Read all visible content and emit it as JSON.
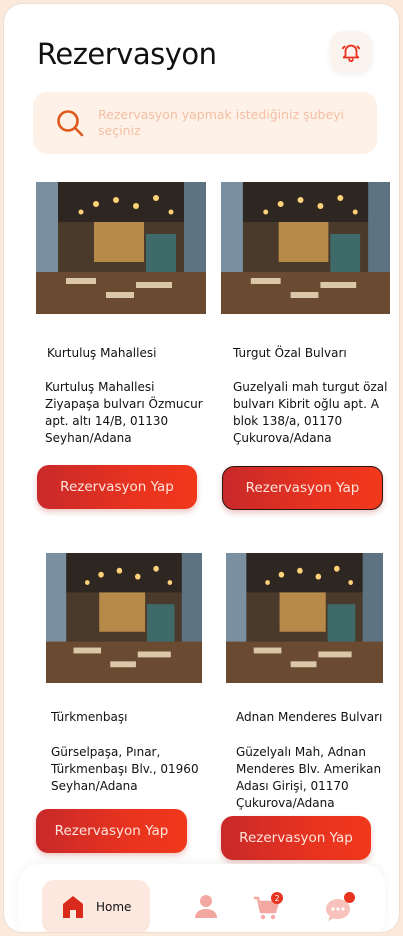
{
  "header": {
    "title": "Rezervasyon"
  },
  "search": {
    "placeholder": "Rezervasyon yapmak istediğiniz şubeyi seçiniz"
  },
  "branches": [
    {
      "title": "Kurtuluş Mahallesi",
      "address": " Kurtuluş Mahallesi\nZiyapaşa bulvarı Özmucur\napt. altı 14/B, 01130\nSeyhan/Adana",
      "button": "Rezervasyon Yap"
    },
    {
      "title": "Turgut Özal Bulvarı",
      "address": "Guzelyali mah turgut özal\nbulvarı Kibrit oğlu apt. A\nblok 138/a, 01170\nÇukurova/Adana",
      "button": "Rezervasyon Yap"
    },
    {
      "title": "Türkmenbaşı",
      "address": "Gürselpaşa, Pınar,\nTürkmenbaşı Blv., 01960\nSeyhan/Adana",
      "button": "Rezervasyon Yap"
    },
    {
      "title": "Adnan Menderes Bulvarı",
      "address": "Güzelyalı Mah, Adnan\nMenderes Blv. Amerikan\nAdası Girişi, 01170\nÇukurova/Adana",
      "button": "Rezervasyon Yap"
    }
  ],
  "tabbar": {
    "home_label": "Home",
    "cart_count": "2",
    "icons": [
      "home-icon",
      "profile-icon",
      "cart-icon",
      "chat-icon"
    ]
  },
  "colors": {
    "accent": "#e8331f",
    "accent_dark": "#c8292a",
    "search_bg": "#fdf1e8",
    "placeholder": "#f4bfa3"
  }
}
